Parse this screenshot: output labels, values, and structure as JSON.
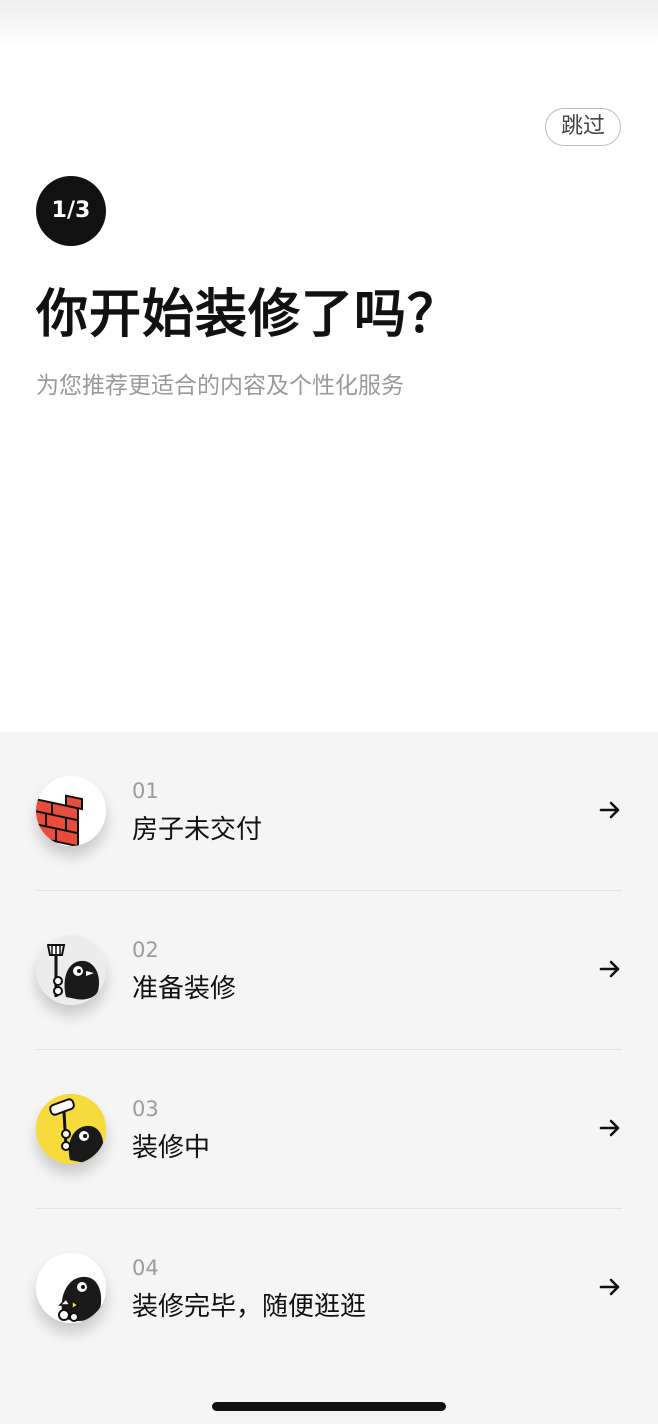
{
  "skip_label": "跳过",
  "step": "1/3",
  "title": "你开始装修了吗？",
  "subtitle": "为您推荐更适合的内容及个性化服务",
  "options": [
    {
      "number": "01",
      "label": "房子未交付",
      "icon": "brick-wall-icon"
    },
    {
      "number": "02",
      "label": "准备装修",
      "icon": "penguin-with-broom-icon"
    },
    {
      "number": "03",
      "label": "装修中",
      "icon": "penguin-with-paint-roller-icon"
    },
    {
      "number": "04",
      "label": "装修完毕，随便逛逛",
      "icon": "penguin-relaxing-icon"
    }
  ],
  "colors": {
    "background": "#ffffff",
    "options_background": "#f5f5f5",
    "badge": "#111111",
    "subtitle": "#9a9a9a",
    "number": "#9c9c9c",
    "brick": "#e84c3d",
    "yellow_avatar": "#f6db3c"
  }
}
